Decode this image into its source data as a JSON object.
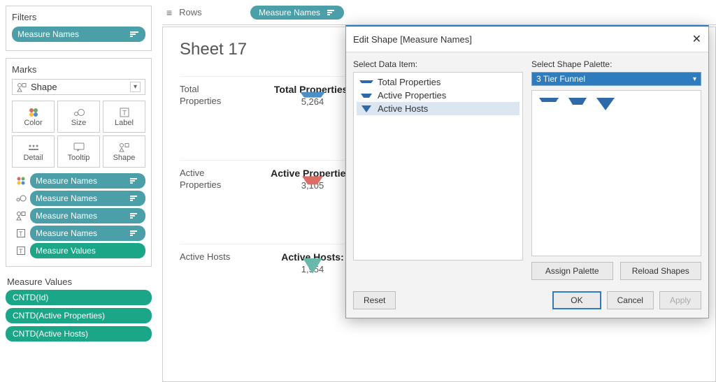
{
  "shelf": {
    "rows_label": "Rows",
    "rows_pill": "Measure Names"
  },
  "filters": {
    "title": "Filters",
    "pill": "Measure Names"
  },
  "marks": {
    "title": "Marks",
    "mark_type": "Shape",
    "buttons": [
      "Color",
      "Size",
      "Label",
      "Detail",
      "Tooltip",
      "Shape"
    ],
    "pills": [
      {
        "icon": "color",
        "text": "Measure Names"
      },
      {
        "icon": "size",
        "text": "Measure Names"
      },
      {
        "icon": "shape",
        "text": "Measure Names"
      },
      {
        "icon": "label",
        "text": "Measure Names"
      },
      {
        "icon": "label",
        "text": "Measure Values",
        "green": true
      }
    ]
  },
  "measure_values": {
    "title": "Measure Values",
    "items": [
      "CNTD(Id)",
      "CNTD(Active Properties)",
      "CNTD(Active Hosts)"
    ]
  },
  "viz": {
    "sheet_title": "Sheet 17",
    "rows": [
      {
        "header": "Total Properties",
        "label": "Total Properties:",
        "value": "5,264"
      },
      {
        "header": "Active Properties",
        "label": "Active Properties:",
        "value": "3,105"
      },
      {
        "header": "Active Hosts",
        "label": "Active Hosts:",
        "value": "1,954"
      }
    ]
  },
  "dialog": {
    "title": "Edit Shape [Measure Names]",
    "left_label": "Select Data Item:",
    "right_label": "Select Shape Palette:",
    "palette_selected": "3 Tier Funnel",
    "items": [
      {
        "name": "Total Properties",
        "selected": false
      },
      {
        "name": "Active Properties",
        "selected": false
      },
      {
        "name": "Active Hosts",
        "selected": true
      }
    ],
    "buttons": {
      "assign": "Assign Palette",
      "reload": "Reload Shapes",
      "reset": "Reset",
      "ok": "OK",
      "cancel": "Cancel",
      "apply": "Apply"
    }
  }
}
